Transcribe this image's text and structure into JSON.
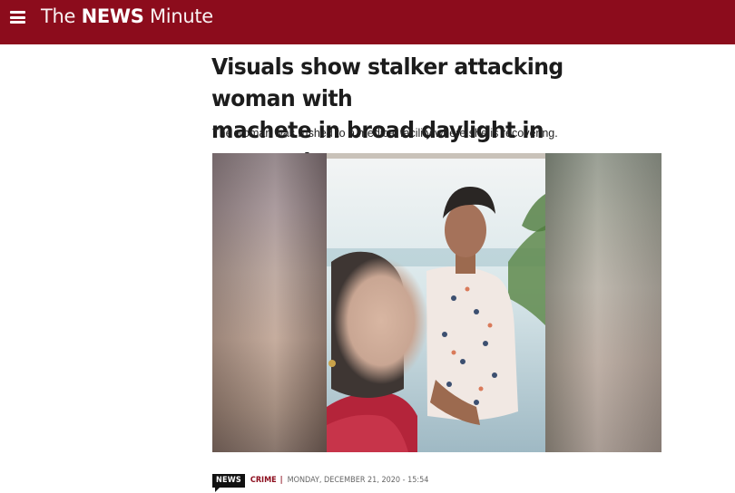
{
  "header": {
    "logo_the": "The",
    "logo_news": "NEWS",
    "logo_minute": "Minute",
    "brand_color": "#8c0c1c"
  },
  "article": {
    "headline_line1": "Visuals show stalker attacking woman with",
    "headline_line2": "machete in broad daylight in Karnataka",
    "subheadline": "The woman was rushed to a medical facility where she is recovering.",
    "badge": "NEWS",
    "category": "CRIME",
    "separator": "|",
    "date": "MONDAY, DECEMBER 21, 2020 - 15:54"
  },
  "icons": {
    "menu": "hamburger-menu-icon",
    "badge": "news-badge-icon"
  }
}
